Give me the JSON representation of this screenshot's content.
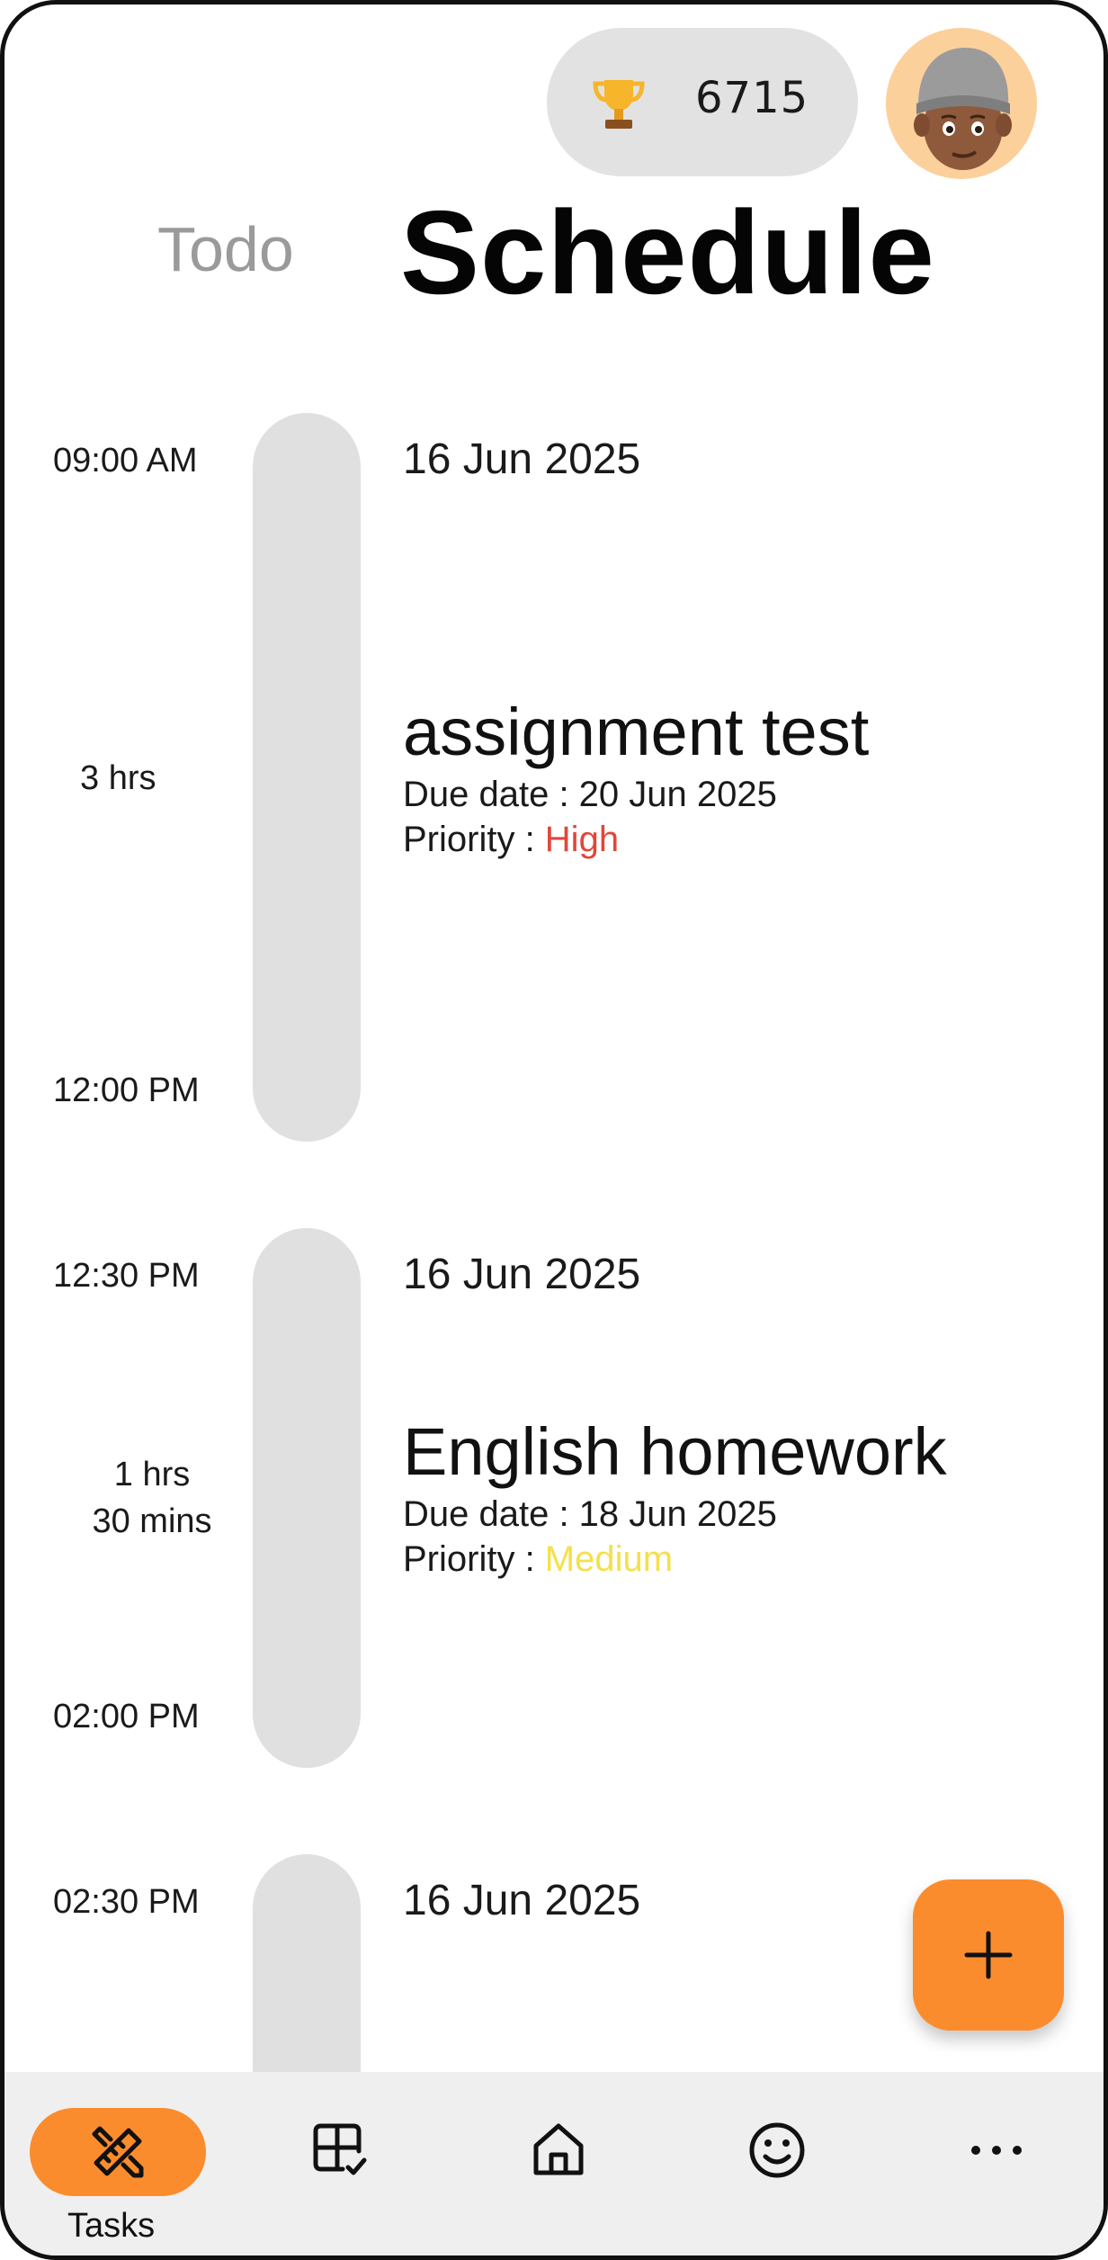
{
  "header": {
    "points": "6715",
    "trophy_icon": "trophy-icon",
    "avatar_icon": "memoji-avatar"
  },
  "tabs": [
    {
      "label": "Todo",
      "active": false
    },
    {
      "label": "Schedule",
      "active": true
    }
  ],
  "schedule": [
    {
      "start_time": "09:00 AM",
      "end_time": "12:00 PM",
      "duration": "3 hrs",
      "date": "16 Jun 2025",
      "title": "assignment test",
      "due_label": "Due date : 20 Jun 2025",
      "priority_label": "Priority : ",
      "priority": "High",
      "priority_color": "#e0473b"
    },
    {
      "start_time": "12:30 PM",
      "end_time": "02:00 PM",
      "duration_line1": "1 hrs",
      "duration_line2": "30 mins",
      "date": "16 Jun 2025",
      "title": "English homework",
      "due_label": "Due date : 18 Jun 2025",
      "priority_label": "Priority : ",
      "priority": "Medium",
      "priority_color": "#f5e04a"
    },
    {
      "start_time": "02:30 PM",
      "date": "16 Jun 2025"
    }
  ],
  "fab": {
    "icon": "plus-icon",
    "color": "#fb8c2d"
  },
  "bottom_nav": {
    "items": [
      {
        "label": "Tasks",
        "icon": "pencil-ruler-icon",
        "active": true
      },
      {
        "icon": "grid-check-icon"
      },
      {
        "icon": "home-icon"
      },
      {
        "icon": "smiley-icon"
      },
      {
        "icon": "more-dots-icon"
      }
    ]
  },
  "colors": {
    "accent": "#fb8c2d",
    "bar": "#e0e0e0",
    "nav_bg": "#efefef"
  }
}
